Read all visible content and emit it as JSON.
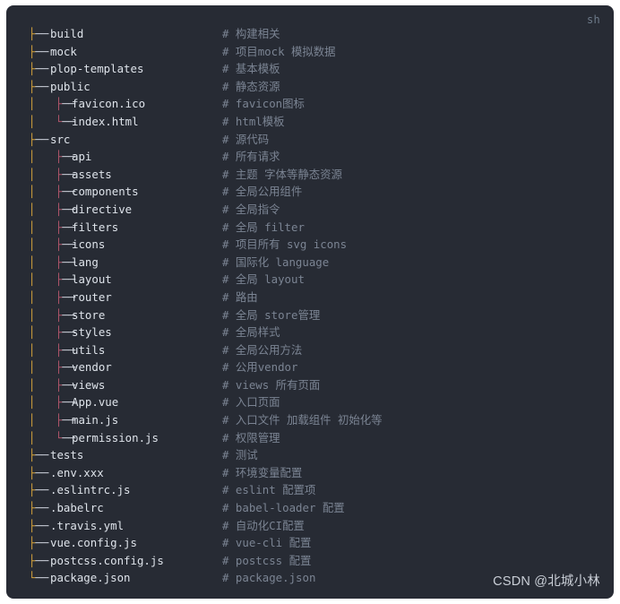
{
  "panel": {
    "language_tag": "sh",
    "background_color": "#272b34",
    "filename_color": "#dee3ea",
    "comment_color": "#7b8493",
    "outer_branch_color": "#d5a33c",
    "nested_branch_color": "#b0556b",
    "dash_color": "#c8cdd6"
  },
  "watermark": {
    "text": "CSDN @北城小林"
  },
  "tree": {
    "rows": [
      {
        "branch": "outer",
        "last": false,
        "depth": 0,
        "name": "build",
        "comment": "# 构建相关"
      },
      {
        "branch": "outer",
        "last": false,
        "depth": 0,
        "name": "mock",
        "comment": "# 项目mock 模拟数据"
      },
      {
        "branch": "outer",
        "last": false,
        "depth": 0,
        "name": "plop-templates",
        "comment": "# 基本模板"
      },
      {
        "branch": "outer",
        "last": false,
        "depth": 0,
        "name": "public",
        "comment": "# 静态资源"
      },
      {
        "branch": "inner",
        "last": false,
        "depth": 1,
        "name": "favicon.ico",
        "comment": "# favicon图标"
      },
      {
        "branch": "inner",
        "last": true,
        "depth": 1,
        "name": "index.html",
        "comment": "# html模板"
      },
      {
        "branch": "outer",
        "last": false,
        "depth": 0,
        "name": "src",
        "comment": "# 源代码"
      },
      {
        "branch": "inner",
        "last": false,
        "depth": 1,
        "name": "api",
        "comment": "# 所有请求"
      },
      {
        "branch": "inner",
        "last": false,
        "depth": 1,
        "name": "assets",
        "comment": "# 主题 字体等静态资源"
      },
      {
        "branch": "inner",
        "last": false,
        "depth": 1,
        "name": "components",
        "comment": "# 全局公用组件"
      },
      {
        "branch": "inner",
        "last": false,
        "depth": 1,
        "name": "directive",
        "comment": "# 全局指令"
      },
      {
        "branch": "inner",
        "last": false,
        "depth": 1,
        "name": "filters",
        "comment": "# 全局 filter"
      },
      {
        "branch": "inner",
        "last": false,
        "depth": 1,
        "name": "icons",
        "comment": "# 项目所有 svg icons"
      },
      {
        "branch": "inner",
        "last": false,
        "depth": 1,
        "name": "lang",
        "comment": "# 国际化 language"
      },
      {
        "branch": "inner",
        "last": false,
        "depth": 1,
        "name": "layout",
        "comment": "# 全局 layout"
      },
      {
        "branch": "inner",
        "last": false,
        "depth": 1,
        "name": "router",
        "comment": "# 路由"
      },
      {
        "branch": "inner",
        "last": false,
        "depth": 1,
        "name": "store",
        "comment": "# 全局 store管理"
      },
      {
        "branch": "inner",
        "last": false,
        "depth": 1,
        "name": "styles",
        "comment": "# 全局样式"
      },
      {
        "branch": "inner",
        "last": false,
        "depth": 1,
        "name": "utils",
        "comment": "# 全局公用方法"
      },
      {
        "branch": "inner",
        "last": false,
        "depth": 1,
        "name": "vendor",
        "comment": "# 公用vendor"
      },
      {
        "branch": "inner",
        "last": false,
        "depth": 1,
        "name": "views",
        "comment": "# views 所有页面"
      },
      {
        "branch": "inner",
        "last": false,
        "depth": 1,
        "name": "App.vue",
        "comment": "# 入口页面"
      },
      {
        "branch": "inner",
        "last": false,
        "depth": 1,
        "name": "main.js",
        "comment": "# 入口文件 加载组件 初始化等"
      },
      {
        "branch": "inner",
        "last": true,
        "depth": 1,
        "name": "permission.js",
        "comment": "# 权限管理"
      },
      {
        "branch": "outer",
        "last": false,
        "depth": 0,
        "name": "tests",
        "comment": "# 测试"
      },
      {
        "branch": "outer",
        "last": false,
        "depth": 0,
        "name": ".env.xxx",
        "comment": "# 环境变量配置"
      },
      {
        "branch": "outer",
        "last": false,
        "depth": 0,
        "name": ".eslintrc.js",
        "comment": "# eslint 配置项"
      },
      {
        "branch": "outer",
        "last": false,
        "depth": 0,
        "name": ".babelrc",
        "comment": "# babel-loader 配置"
      },
      {
        "branch": "outer",
        "last": false,
        "depth": 0,
        "name": ".travis.yml",
        "comment": "# 自动化CI配置"
      },
      {
        "branch": "outer",
        "last": false,
        "depth": 0,
        "name": "vue.config.js",
        "comment": "# vue-cli 配置"
      },
      {
        "branch": "outer",
        "last": false,
        "depth": 0,
        "name": "postcss.config.js",
        "comment": "# postcss 配置"
      },
      {
        "branch": "outer",
        "last": true,
        "depth": 0,
        "name": "package.json",
        "comment": "# package.json"
      }
    ]
  }
}
